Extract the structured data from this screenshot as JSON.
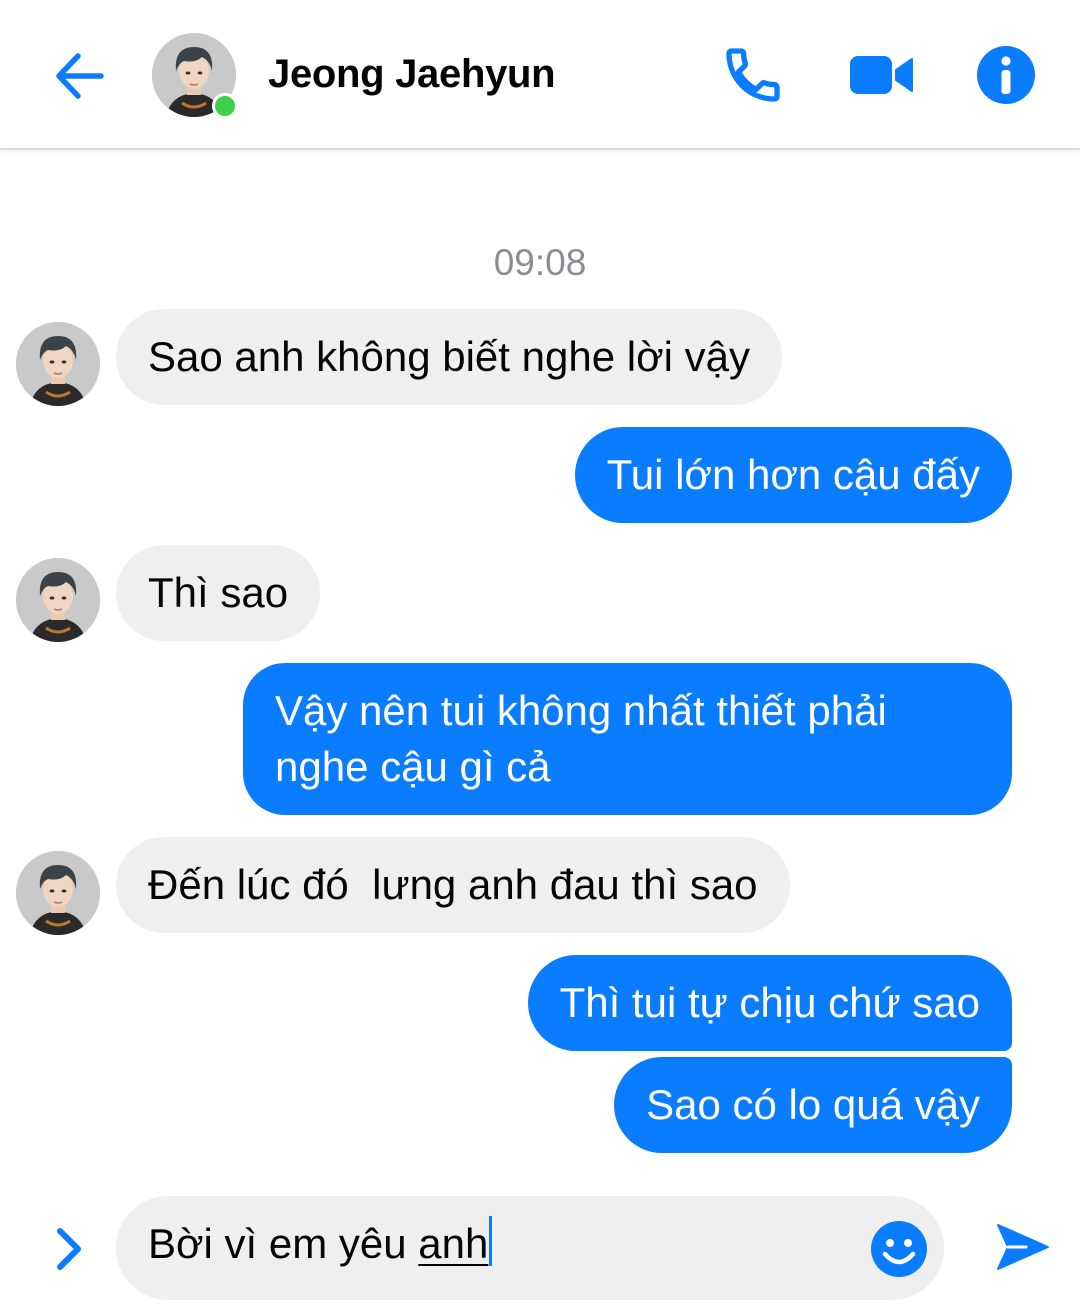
{
  "header": {
    "contact_name": "Jeong Jaehyun",
    "online": true,
    "icons": {
      "back": "back-arrow-icon",
      "call": "phone-icon",
      "video": "video-camera-icon",
      "info": "info-icon"
    }
  },
  "conversation": {
    "timestamp": "09:08",
    "messages": [
      {
        "from": "contact",
        "text": "Sao anh không biết nghe lời vậy"
      },
      {
        "from": "me",
        "text": "Tui lớn hơn cậu đấy"
      },
      {
        "from": "contact",
        "text": "Thì sao"
      },
      {
        "from": "me",
        "text": "Vậy nên tui không nhất thiết phải nghe cậu gì cả"
      },
      {
        "from": "contact",
        "text": "Đến lúc đó  lưng anh đau thì sao"
      },
      {
        "from": "me",
        "text": "Thì tui tự chịu chứ sao"
      },
      {
        "from": "me",
        "text": "Sao có lo quá vậy"
      }
    ]
  },
  "composer": {
    "text_before": "Bời vì em yêu ",
    "text_underlined": "anh",
    "icons": {
      "expand": "chevron-right-icon",
      "emoji": "smiley-icon",
      "send": "send-icon"
    }
  },
  "colors": {
    "accent": "#0a7cff",
    "incoming_bubble": "#efefef",
    "online_dot": "#3fd04a",
    "timestamp_text": "#8a8d91"
  }
}
